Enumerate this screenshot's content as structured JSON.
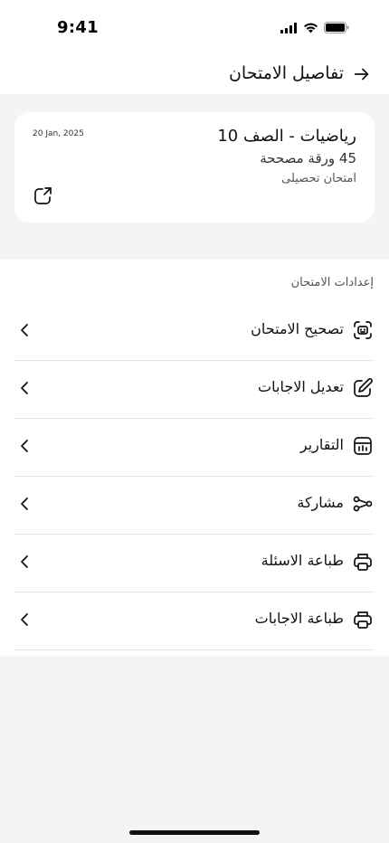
{
  "status_bar": {
    "time": "9:41"
  },
  "header": {
    "title": "تفاصيل الامتحان"
  },
  "exam": {
    "name": "رياضيات - الصف 10",
    "papers": "45 ورقة مصححة",
    "type": "امتحان تحصيلى",
    "date": "20 Jan, 2025"
  },
  "settings": {
    "section_label": "إعدادات الامتحان",
    "items": [
      {
        "label": "تصحيح الامتحان",
        "icon": "scan-icon"
      },
      {
        "label": "تعديل الاجابات",
        "icon": "edit-icon"
      },
      {
        "label": "التقارير",
        "icon": "reports-icon"
      },
      {
        "label": "مشاركة",
        "icon": "share-nodes-icon"
      },
      {
        "label": "طباعة الاسئلة",
        "icon": "printer-icon"
      },
      {
        "label": "طباعة الاجابات",
        "icon": "printer-icon"
      }
    ]
  }
}
